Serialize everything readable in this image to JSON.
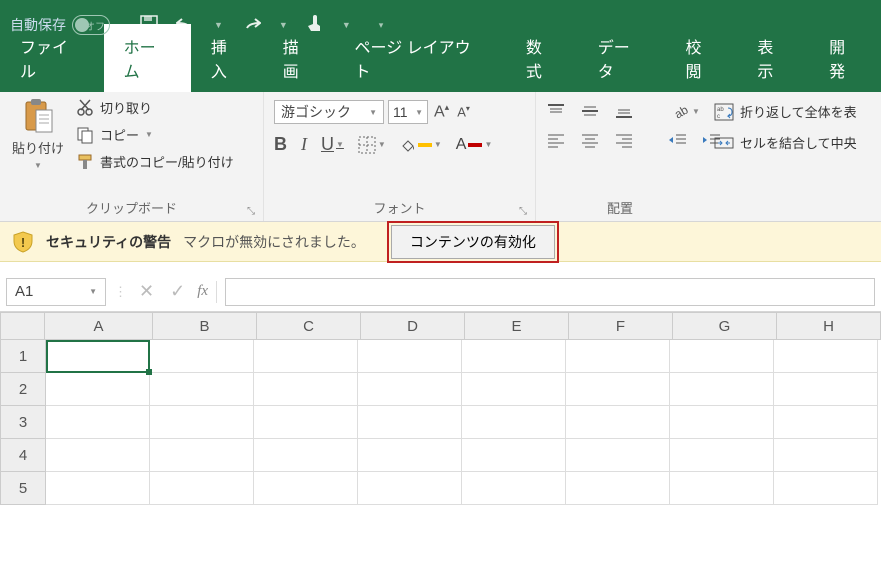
{
  "title_bar": {
    "autosave_label": "自動保存",
    "autosave_state": "オフ"
  },
  "tabs": {
    "file": "ファイル",
    "home": "ホーム",
    "insert": "挿入",
    "draw": "描画",
    "page_layout": "ページ レイアウト",
    "formulas": "数式",
    "data": "データ",
    "review": "校閲",
    "view": "表示",
    "developer": "開発"
  },
  "ribbon": {
    "clipboard": {
      "paste": "貼り付け",
      "cut": "切り取り",
      "copy": "コピー",
      "format_painter": "書式のコピー/貼り付け",
      "group_label": "クリップボード"
    },
    "font": {
      "font_name": "游ゴシック",
      "font_size": "11",
      "group_label": "フォント"
    },
    "alignment": {
      "wrap_text": "折り返して全体を表",
      "merge_center": "セルを結合して中央",
      "group_label": "配置"
    }
  },
  "security": {
    "title": "セキュリティの警告",
    "message": "マクロが無効にされました。",
    "enable_button": "コンテンツの有効化"
  },
  "formula_bar": {
    "name_box": "A1",
    "fx_label": "fx"
  },
  "grid": {
    "columns": [
      "A",
      "B",
      "C",
      "D",
      "E",
      "F",
      "G",
      "H"
    ],
    "rows": [
      "1",
      "2",
      "3",
      "4",
      "5"
    ],
    "active_cell": "A1"
  },
  "colors": {
    "excel_green": "#217346",
    "fill_color": "#ffc000",
    "font_color": "#c00000"
  }
}
